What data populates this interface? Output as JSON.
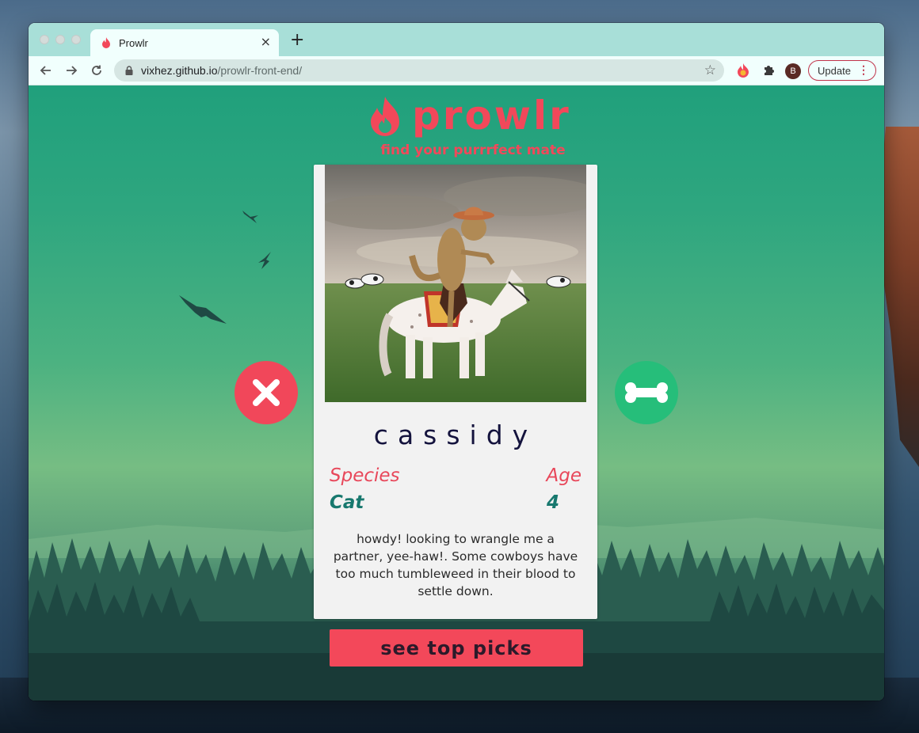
{
  "browser": {
    "tab_title": "Prowlr",
    "tab_close": "×",
    "new_tab": "+",
    "url_domain": "vixhez.github.io",
    "url_path": "/prowlr-front-end/",
    "profile_initial": "B",
    "update_label": "Update",
    "menu_glyph": "⋮",
    "icons": [
      "back-arrow-icon",
      "forward-arrow-icon",
      "reload-icon",
      "lock-icon",
      "star-icon",
      "extension-fire-icon",
      "extensions-puzzle-icon"
    ]
  },
  "app": {
    "logo_text": "prowlr",
    "tagline": "find your purrrfect mate",
    "profile": {
      "name": "cassidy",
      "species_label": "Species",
      "age_label": "Age",
      "species": "Cat",
      "age": "4",
      "bio": "howdy! looking to wrangle me a partner, yee-haw!. Some cowboys have too much tumbleweed in their blood to settle down."
    },
    "top_picks_label": "see top picks",
    "colors": {
      "accent": "#f2485a",
      "like": "#26be7a",
      "name": "#14133d",
      "value": "#17786e"
    }
  }
}
